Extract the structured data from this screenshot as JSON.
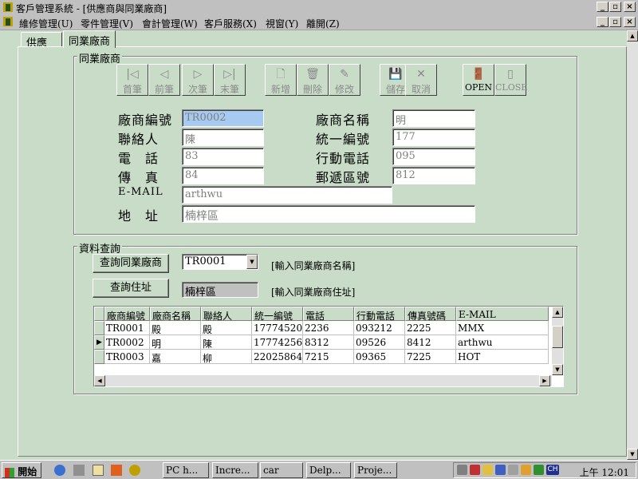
{
  "window": {
    "title": "客戶管理系統 - [供應商與同業廠商]",
    "controls": {
      "minimize": "_",
      "restore": "▫",
      "close": "×"
    }
  },
  "menu": [
    "維修管理(U)",
    "零件管理(V)",
    "會計管理(W)",
    "客戶服務(X)",
    "視窗(Y)",
    "離開(Z)"
  ],
  "tabs": [
    {
      "label": "供應商",
      "active": false
    },
    {
      "label": "同業廠商",
      "active": true
    }
  ],
  "group_peer": {
    "title": "同業廠商"
  },
  "toolbar": [
    {
      "label": "首筆",
      "icon": "first-record-icon",
      "glyph": "|◁",
      "enabled": false
    },
    {
      "label": "前筆",
      "icon": "prev-record-icon",
      "glyph": "◁",
      "enabled": false
    },
    {
      "label": "次筆",
      "icon": "next-record-icon",
      "glyph": "▷",
      "enabled": false
    },
    {
      "label": "末筆",
      "icon": "last-record-icon",
      "glyph": "▷|",
      "enabled": false
    },
    {
      "label": "新增",
      "icon": "new-document-icon",
      "glyph": "🗋",
      "enabled": false
    },
    {
      "label": "刪除",
      "icon": "trash-icon",
      "glyph": "🗑",
      "enabled": false
    },
    {
      "label": "修改",
      "icon": "edit-icon",
      "glyph": "✎",
      "enabled": false
    },
    {
      "label": "儲存",
      "icon": "save-disk-icon",
      "glyph": "💾",
      "enabled": false
    },
    {
      "label": "取消",
      "icon": "cancel-x-icon",
      "glyph": "✕",
      "enabled": false
    },
    {
      "label": "OPEN",
      "icon": "open-door-icon",
      "glyph": "🚪",
      "enabled": true
    },
    {
      "label": "CLOSE",
      "icon": "close-door-icon",
      "glyph": "▯",
      "enabled": false
    }
  ],
  "form": {
    "vendor_id": {
      "label": "廠商編號",
      "value": "TR0002"
    },
    "vendor_name": {
      "label": "廠商名稱",
      "value": "明"
    },
    "contact": {
      "label": "聯絡人",
      "value": "陳"
    },
    "tax_id": {
      "label": "統一編號",
      "value": "177"
    },
    "phone": {
      "label": "電　話",
      "value": "83"
    },
    "mobile": {
      "label": "行動電話",
      "value": "095"
    },
    "fax": {
      "label": "傳　真",
      "value": "84"
    },
    "zip": {
      "label": "郵遞區號",
      "value": "812"
    },
    "email": {
      "label": "E-MAIL",
      "value": "arthwu"
    },
    "address": {
      "label": "地　址",
      "value": "楠梓區"
    }
  },
  "group_query": {
    "title": "資料查詢"
  },
  "query": {
    "by_name_button": "查詢同業廠商",
    "name_select_value": "TR0001",
    "name_hint": "[輸入同業廠商名稱]",
    "by_address_button": "查詢住址",
    "address_value": "楠梓區",
    "address_hint": "[輸入同業廠商住址]"
  },
  "grid": {
    "columns": [
      "廠商編號",
      "廠商名稱",
      "聯絡人",
      "統一編號",
      "電話",
      "行動電話",
      "傳真號碼",
      "E-MAIL"
    ],
    "rows": [
      [
        "TR0001",
        "殿",
        "殿",
        "17774520",
        "2236",
        "093212",
        "2225",
        "MMX"
      ],
      [
        "TR0002",
        "明",
        "陳",
        "17774256",
        "8312",
        "09526",
        "8412",
        "arthwu"
      ],
      [
        "TR0003",
        "嘉",
        "柳",
        "22025864",
        "7215",
        "09365",
        "7225",
        "HOT"
      ]
    ],
    "current_row": 1
  },
  "taskbar": {
    "start": "開始",
    "buttons": [
      "PC h...",
      "Incre...",
      "car",
      "Delp...",
      "Proje..."
    ],
    "clock": "上午 12:01",
    "ime": "CH"
  }
}
